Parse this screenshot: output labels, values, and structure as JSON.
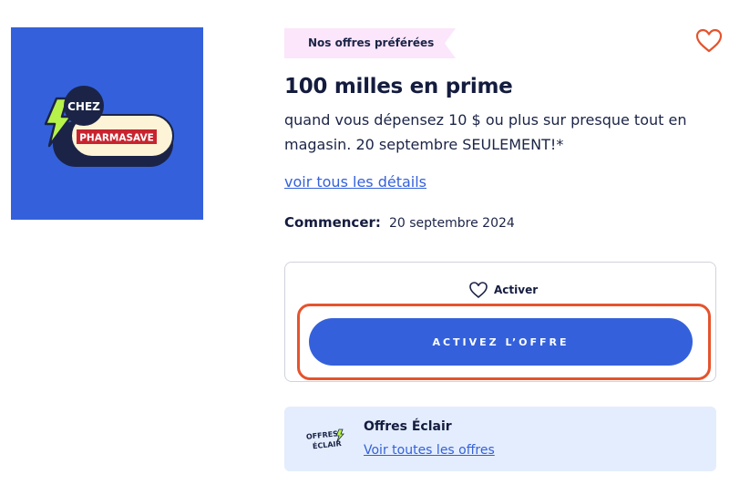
{
  "brand_logo": {
    "text_top": "CHEZ",
    "text_main": "PHARMASAVE",
    "colors": {
      "tile": "#3461db",
      "bolt": "#b6f24a",
      "pill": "#fdf3d6",
      "navy": "#1b2447",
      "red": "#c8242f"
    },
    "icon": "lightning-bolt-icon"
  },
  "badge": {
    "label": "Nos offres préférées",
    "color": "#fbe6fb"
  },
  "favorite": {
    "icon": "heart-outline-icon",
    "color": "#e5532d"
  },
  "offer": {
    "title": "100 milles en prime",
    "description": "quand vous dépensez 10 $ ou plus sur presque tout en magasin. 20 septembre SEULEMENT!*",
    "details_link": "voir tous les détails",
    "start_label": "Commencer:",
    "start_date": "20 septembre 2024"
  },
  "activate": {
    "toggle_icon": "heart-outline-icon",
    "toggle_label": "Activer",
    "button_label": "ACTIVEZ L’OFFRE",
    "button_color": "#3461db",
    "highlight_color": "#e5532d"
  },
  "flash": {
    "logo_text_1": "OFFRES",
    "logo_text_2": "ÉCLAIR",
    "title": "Offres Éclair",
    "link": "Voir toutes les offres",
    "background": "#e3edfd"
  }
}
